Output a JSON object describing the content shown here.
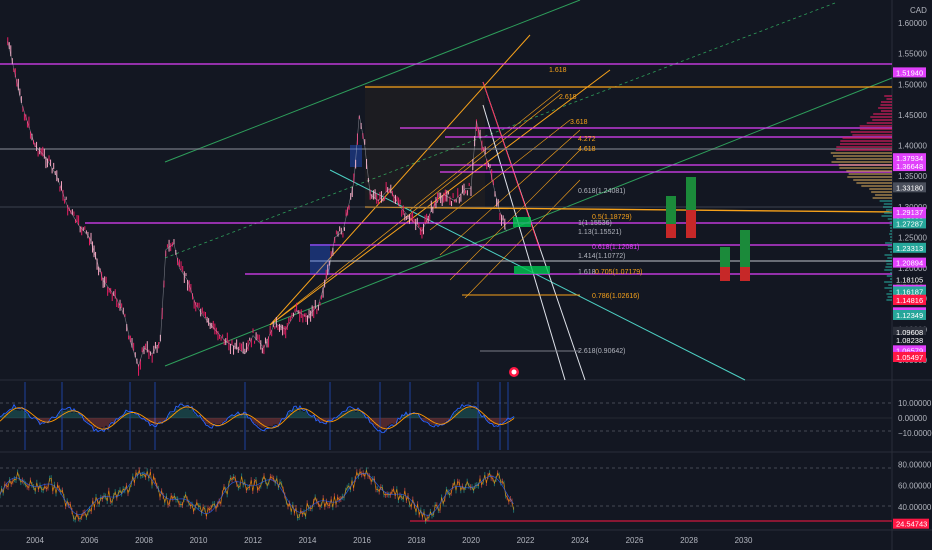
{
  "currency": "CAD",
  "chart_data": [
    {
      "type": "line",
      "pane": "price",
      "x_ticks": [
        "2004",
        "2006",
        "2008",
        "2010",
        "2012",
        "2014",
        "2016",
        "2018",
        "2020",
        "2022",
        "2024",
        "2026",
        "2028",
        "2030"
      ],
      "x_tick_years": [
        2004,
        2006,
        2008,
        2010,
        2012,
        2014,
        2016,
        2018,
        2020,
        2022,
        2024,
        2026,
        2028,
        2030
      ],
      "xlim": [
        2003,
        2034
      ],
      "y_ticks": [
        "1.60000",
        "1.55000",
        "1.50000",
        "1.45000",
        "1.40000",
        "1.35000",
        "1.30000",
        "1.25000",
        "1.20000",
        "1.15000",
        "1.10000",
        "1.05000"
      ],
      "ylim": [
        1.0,
        1.62
      ],
      "series": [
        {
          "x": [
            2003.0,
            2003.5,
            2004.0,
            2004.4,
            2004.8,
            2005.2,
            2005.6,
            2006.0,
            2006.5,
            2007.0,
            2007.3,
            2007.5,
            2007.8,
            2008.0,
            2008.3,
            2008.6,
            2008.8,
            2009.1,
            2009.3,
            2009.6,
            2009.9,
            2010.2,
            2010.6,
            2011.0,
            2011.4,
            2011.7,
            2012.0,
            2012.4,
            2012.8,
            2013.2,
            2013.6,
            2014.0,
            2014.4,
            2014.8,
            2015.0,
            2015.3,
            2015.7,
            2015.9,
            2016.1,
            2016.3,
            2016.6,
            2017.0,
            2017.4,
            2017.8,
            2018.2,
            2018.6,
            2019.0,
            2019.4,
            2019.8,
            2020.0,
            2020.2,
            2020.4,
            2020.7,
            2021.0,
            2021.3
          ],
          "values": [
            1.57,
            1.47,
            1.4,
            1.38,
            1.35,
            1.3,
            1.27,
            1.25,
            1.18,
            1.15,
            1.12,
            1.08,
            1.04,
            1.07,
            1.06,
            1.08,
            1.23,
            1.24,
            1.2,
            1.18,
            1.14,
            1.12,
            1.1,
            1.08,
            1.07,
            1.06,
            1.09,
            1.07,
            1.11,
            1.1,
            1.13,
            1.12,
            1.14,
            1.2,
            1.25,
            1.26,
            1.34,
            1.45,
            1.4,
            1.32,
            1.31,
            1.33,
            1.3,
            1.28,
            1.26,
            1.3,
            1.32,
            1.31,
            1.33,
            1.33,
            1.44,
            1.4,
            1.36,
            1.3,
            1.26
          ]
        }
      ],
      "annotations": {
        "fib_labels": [
          "1.618",
          "2.618",
          "3.618",
          "4.272",
          "4.618",
          "0.618(1.24081)",
          "0.5(1.18729)",
          "1(1.15536)",
          "1.13(1.15521)",
          "0.618(1.12081)",
          "1.414(1.10772)",
          "1.618",
          "0.705(1.07179)",
          "0.786(1.02616)",
          "2.618(0.90642)"
        ],
        "price_badges": [
          {
            "label": "1.51940",
            "color": "#e040fb"
          },
          {
            "label": "1.37934",
            "color": "#e040fb"
          },
          {
            "label": "1.36648",
            "color": "#e040fb"
          },
          {
            "label": "1.33180",
            "color": "#4a4f5c"
          },
          {
            "label": "1.29137",
            "color": "#e040fb"
          },
          {
            "label": "1.27823",
            "color": "#e040fb"
          },
          {
            "label": "1.27287",
            "color": "#26a69a"
          },
          {
            "label": "1.23313",
            "color": "#26a69a"
          },
          {
            "label": "1.20894",
            "color": "#e040fb"
          },
          {
            "label": "3d 3h",
            "color": "#e040fb"
          },
          {
            "label": "1.18105",
            "color": "#131722"
          },
          {
            "label": "1.17753",
            "color": "#e040fb"
          },
          {
            "label": "1.18105",
            "color": "#131722"
          },
          {
            "label": "1.16187",
            "color": "#26a69a"
          },
          {
            "label": "1.14816",
            "color": "#ff1744"
          },
          {
            "label": "1.14816",
            "color": "#ff1744"
          },
          {
            "label": "1.12785",
            "color": "#e040fb"
          },
          {
            "label": "1.12349",
            "color": "#26a69a"
          },
          {
            "label": "1.09608",
            "color": "#2a2e39"
          },
          {
            "label": "1.08238",
            "color": "#131722"
          },
          {
            "label": "1.08238",
            "color": "#131722"
          },
          {
            "label": "1.06579",
            "color": "#e040fb"
          },
          {
            "label": "1.05497",
            "color": "#ff1744"
          },
          {
            "label": "1.05497",
            "color": "#ff1744"
          }
        ]
      }
    },
    {
      "type": "line",
      "pane": "oscillator",
      "y_ticks": [
        "10.00000",
        "0.00000",
        "−10.00000"
      ],
      "ylim": [
        -15,
        15
      ]
    },
    {
      "type": "line",
      "pane": "rsi",
      "y_ticks": [
        "80.00000",
        "60.00000",
        "40.00000"
      ],
      "ylim": [
        20,
        90
      ],
      "last_value": "24.54743",
      "last_color": "#ff1744"
    }
  ]
}
